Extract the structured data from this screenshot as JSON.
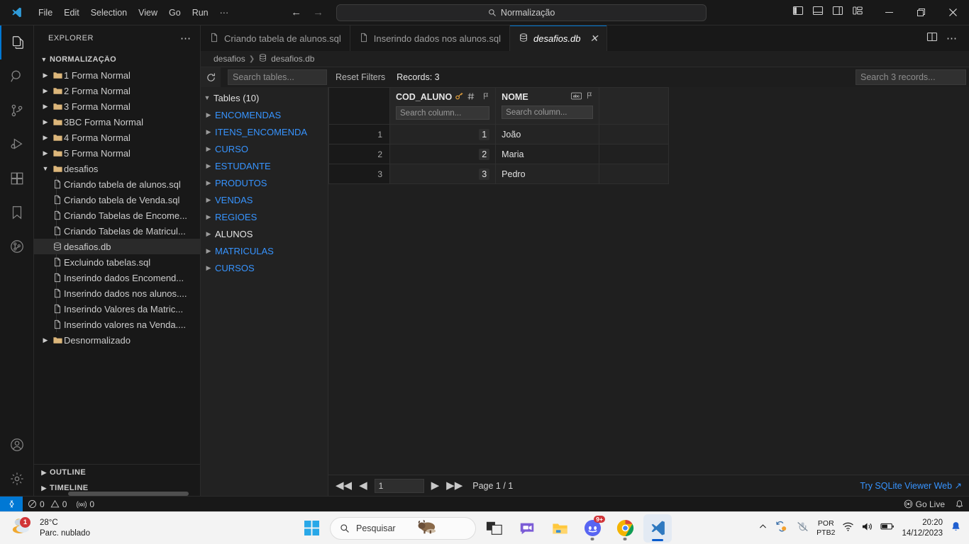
{
  "titlebar": {
    "menu": [
      "File",
      "Edit",
      "Selection",
      "View",
      "Go",
      "Run",
      "···"
    ],
    "search_value": "Normalização",
    "back_icon": "arrow-left-icon",
    "forward_icon": "arrow-right-icon"
  },
  "activitybar": {
    "items": [
      {
        "name": "explorer",
        "active": true
      },
      {
        "name": "search",
        "active": false
      },
      {
        "name": "source-control",
        "active": false
      },
      {
        "name": "run-and-debug",
        "active": false
      },
      {
        "name": "extensions",
        "active": false
      },
      {
        "name": "bookmarks",
        "active": false
      },
      {
        "name": "gitlens",
        "active": false
      }
    ],
    "bottom": [
      {
        "name": "accounts"
      },
      {
        "name": "settings"
      }
    ]
  },
  "sidebar": {
    "title": "EXPLORER",
    "root": "NORMALIZAÇÃO",
    "folders": [
      {
        "label": "1 Forma Normal",
        "expanded": false
      },
      {
        "label": "2 Forma Normal",
        "expanded": false
      },
      {
        "label": "3 Forma Normal",
        "expanded": false
      },
      {
        "label": "3BC Forma Normal",
        "expanded": false
      },
      {
        "label": "4 Forma Normal",
        "expanded": false
      },
      {
        "label": "5 Forma Normal",
        "expanded": false
      },
      {
        "label": "desafios",
        "expanded": true
      }
    ],
    "files": [
      {
        "label": "Criando tabela de alunos.sql",
        "type": "sql",
        "selected": false
      },
      {
        "label": "Criando tabela de Venda.sql",
        "type": "sql",
        "selected": false
      },
      {
        "label": "Criando Tabelas de Encome...",
        "type": "sql",
        "selected": false
      },
      {
        "label": "Criando Tabelas de Matricul...",
        "type": "sql",
        "selected": false
      },
      {
        "label": "desafios.db",
        "type": "db",
        "selected": true
      },
      {
        "label": "Excluindo tabelas.sql",
        "type": "sql",
        "selected": false
      },
      {
        "label": "Inserindo dados Encomend...",
        "type": "sql",
        "selected": false
      },
      {
        "label": "Inserindo dados nos alunos....",
        "type": "sql",
        "selected": false
      },
      {
        "label": "Inserindo Valores da Matric...",
        "type": "sql",
        "selected": false
      },
      {
        "label": "Inserindo valores na Venda....",
        "type": "sql",
        "selected": false
      }
    ],
    "trailing_folder": {
      "label": "Desnormalizado",
      "expanded": false
    },
    "sections": [
      "OUTLINE",
      "TIMELINE"
    ]
  },
  "editor": {
    "tabs": [
      {
        "label": "Criando tabela de alunos.sql",
        "type": "sql",
        "active": false,
        "closable": false
      },
      {
        "label": "Inserindo dados nos alunos.sql",
        "type": "sql",
        "active": false,
        "closable": false
      },
      {
        "label": "desafios.db",
        "type": "db",
        "active": true,
        "closable": true
      }
    ],
    "breadcrumb": [
      "desafios",
      "desafios.db"
    ]
  },
  "sqlite": {
    "refresh_icon": "refresh-icon",
    "table_search_placeholder": "Search tables...",
    "reset_filters_label": "Reset Filters",
    "records_label": "Records: 3",
    "record_search_placeholder": "Search 3 records...",
    "tables_group_label": "Tables (10)",
    "tables": [
      {
        "name": "ENCOMENDAS",
        "selected": false
      },
      {
        "name": "ITENS_ENCOMENDA",
        "selected": false
      },
      {
        "name": "CURSO",
        "selected": false
      },
      {
        "name": "ESTUDANTE",
        "selected": false
      },
      {
        "name": "PRODUTOS",
        "selected": false
      },
      {
        "name": "VENDAS",
        "selected": false
      },
      {
        "name": "REGIOES",
        "selected": false
      },
      {
        "name": "ALUNOS",
        "selected": true
      },
      {
        "name": "MATRICULAS",
        "selected": false
      },
      {
        "name": "CURSOS",
        "selected": false
      }
    ],
    "columns": [
      {
        "name": "COD_ALUNO",
        "type_icon": "hash-icon",
        "primary_key": true,
        "pin_icon": "pin-icon",
        "filter_placeholder": "Search column..."
      },
      {
        "name": "NOME",
        "type_icon": "abc-icon",
        "primary_key": false,
        "pin_icon": "pin-icon",
        "filter_placeholder": "Search column..."
      }
    ],
    "rows": [
      {
        "num": "1",
        "COD_ALUNO": "1",
        "NOME": "João"
      },
      {
        "num": "2",
        "COD_ALUNO": "2",
        "NOME": "Maria"
      },
      {
        "num": "3",
        "COD_ALUNO": "3",
        "NOME": "Pedro"
      }
    ],
    "pagination": {
      "first_icon": "first-page-icon",
      "prev_icon": "prev-page-icon",
      "page_value": "1",
      "next_icon": "next-page-icon",
      "last_icon": "last-page-icon",
      "page_label": "Page 1 / 1"
    },
    "try_link": "Try SQLite Viewer Web ↗"
  },
  "statusbar": {
    "remote_icon": "remote-window-icon",
    "errors": "0",
    "warnings": "0",
    "ports": "0",
    "go_live": "Go Live",
    "bell_icon": "bell-icon"
  },
  "taskbar": {
    "weather_temp": "28°C",
    "weather_desc": "Parc. nublado",
    "weather_badge": "1",
    "search_placeholder": "Pesquisar",
    "apps": [
      {
        "name": "start-button"
      },
      {
        "name": "task-view"
      },
      {
        "name": "chat"
      },
      {
        "name": "file-explorer"
      },
      {
        "name": "discord",
        "badge": "9+"
      },
      {
        "name": "chrome"
      },
      {
        "name": "vscode",
        "active": true
      }
    ],
    "tray": {
      "lang_line1": "POR",
      "lang_line2": "PTB2",
      "time": "20:20",
      "date": "14/12/2023"
    }
  },
  "colors": {
    "accent": "#0078d4",
    "link": "#3794ff",
    "folder": "#dcb67a",
    "key": "#e8a33d",
    "badge_red": "#d13438"
  }
}
